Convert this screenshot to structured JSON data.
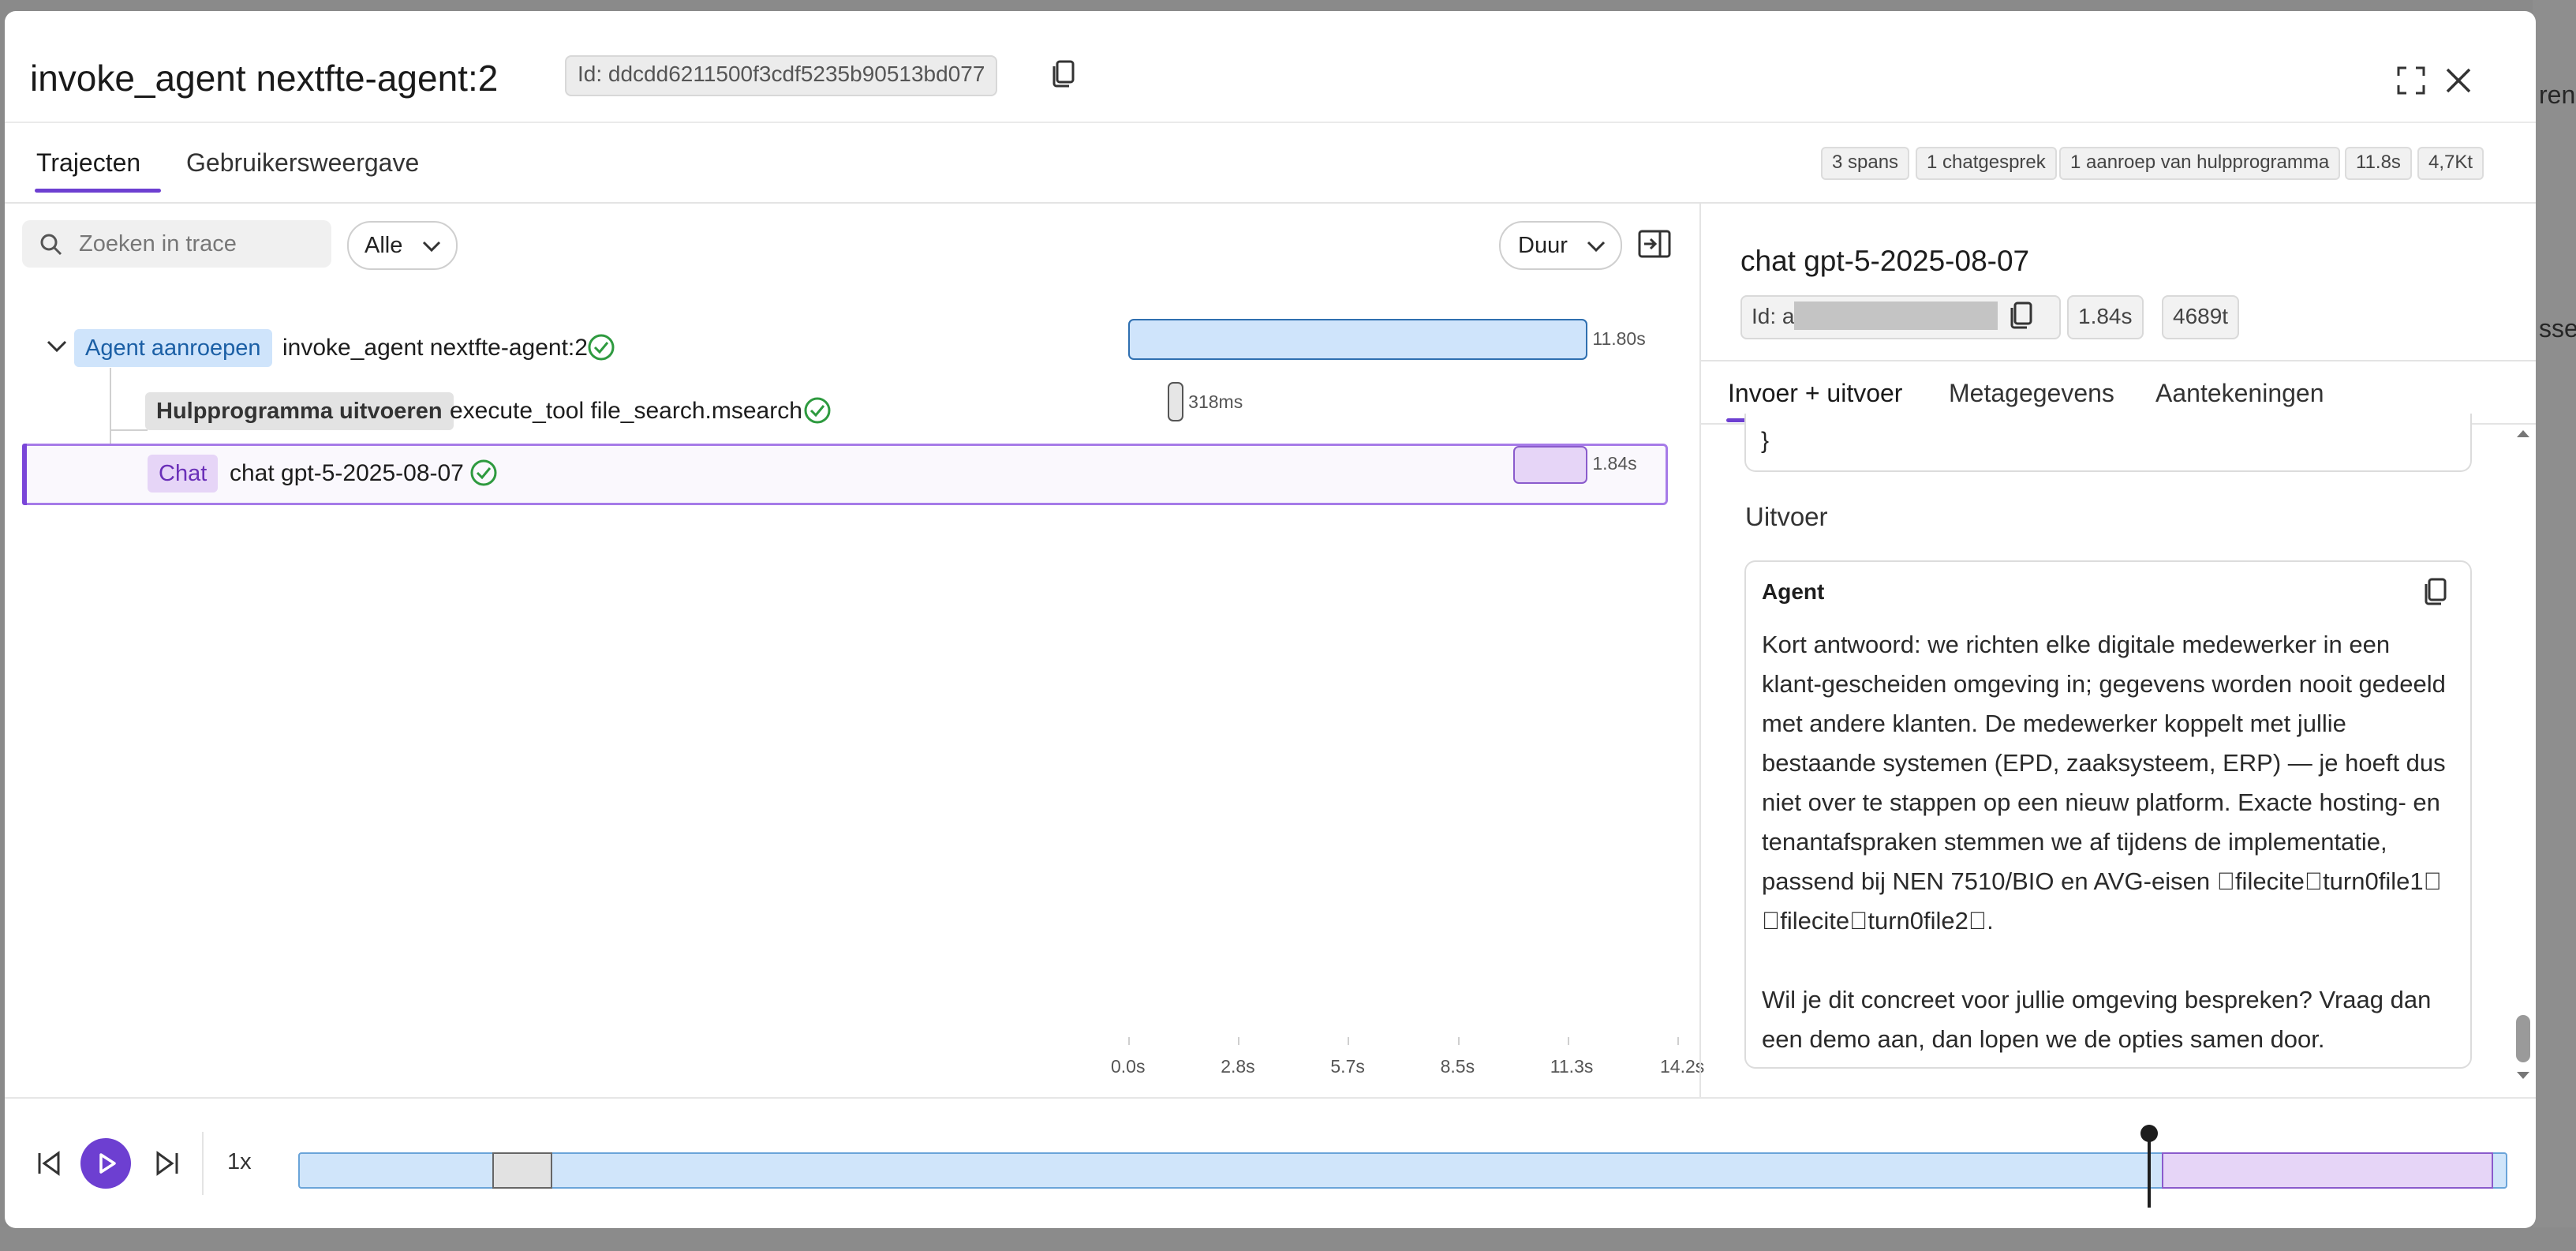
{
  "background": {
    "right_top_text": "ren",
    "right_mid_text": "sse"
  },
  "header": {
    "title": "invoke_agent nextfte-agent:2",
    "id_chip": "Id: ddcdd6211500f3cdf5235b90513bd077"
  },
  "tabs": [
    {
      "label": "Trajecten",
      "active": true
    },
    {
      "label": "Gebruikersweergave",
      "active": false
    }
  ],
  "stats": [
    "3 spans",
    "1 chatgesprek",
    "1 aanroep van hulpprogramma",
    "11.8s",
    "4,7Kt"
  ],
  "toolbar": {
    "search_placeholder": "Zoeken in trace",
    "filter_label": "Alle",
    "sort_label": "Duur"
  },
  "spans": [
    {
      "badge": "Agent aanroepen",
      "name": "invoke_agent nextfte-agent:2",
      "duration": "11.80s",
      "start_s": 0.0,
      "end_s": 11.8,
      "status": "ok"
    },
    {
      "badge": "Hulpprogramma uitvoeren",
      "name": "execute_tool file_search.msearch",
      "duration": "318ms",
      "start_s": 1.03,
      "end_s": 1.35,
      "status": "ok"
    },
    {
      "badge": "Chat",
      "name": "chat gpt-5-2025-08-07",
      "duration": "1.84s",
      "start_s": 9.96,
      "end_s": 11.8,
      "status": "ok",
      "selected": true
    }
  ],
  "axis_ticks": [
    "0.0s",
    "2.8s",
    "5.7s",
    "8.5s",
    "11.3s",
    "14.2s"
  ],
  "detail": {
    "title": "chat gpt-5-2025-08-07",
    "id_prefix": "Id: a",
    "duration": "1.84s",
    "tokens": "4689t",
    "tabs": [
      {
        "label": "Invoer + uitvoer",
        "active": true
      },
      {
        "label": "Metagegevens",
        "active": false
      },
      {
        "label": "Aantekeningen",
        "active": false
      }
    ],
    "code_tail": "}",
    "output_heading": "Uitvoer",
    "output_role": "Agent",
    "output_text": "Kort antwoord: we richten elke digitale medewerker in een klant-gescheiden omgeving in; gegevens worden nooit gedeeld met andere klanten. De medewerker koppelt met jullie bestaande systemen (EPD, zaaksysteem, ERP) — je hoeft dus niet over te stappen op een nieuw platform. Exacte hosting- en tenantafspraken stemmen we af tijdens de implementatie, passend bij NEN 7510/BIO en AVG-eisen fileciteturn0file1 fileciteturn0file2.\n\nWil je dit concreet voor jullie omgeving bespreken? Vraag dan een demo aan, dan lopen we de opties samen door."
  },
  "player": {
    "speed": "1x",
    "playhead_s": 9.96,
    "total_s": 11.8
  },
  "colors": {
    "accent": "#6d3fd1",
    "agent_bar": "#cfe4fb",
    "chat_bar": "#e6d5f7",
    "ok_green": "#2e9a3f"
  }
}
